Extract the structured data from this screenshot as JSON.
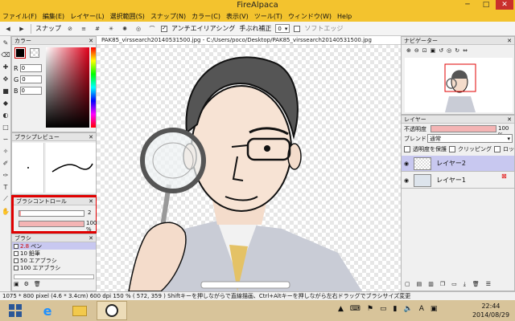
{
  "window": {
    "title": "FireAlpaca"
  },
  "menu": [
    "ファイル(F)",
    "編集(E)",
    "レイヤー(L)",
    "選択範囲(S)",
    "スナップ(N)",
    "カラー(C)",
    "表示(V)",
    "ツール(T)",
    "ウィンドウ(W)",
    "Help"
  ],
  "toolbar": {
    "snap_label": "スナップ",
    "antialias_label": "アンチエイリアシング",
    "stabilizer_label": "手ぶれ補正",
    "stabilizer_value": "0",
    "soft_edge_label": "ソフトエッジ"
  },
  "color_panel": {
    "title": "カラー",
    "r_label": "R",
    "g_label": "G",
    "b_label": "B",
    "r": "0",
    "g": "0",
    "b": "0",
    "fg_color": "#000000"
  },
  "brush_preview": {
    "title": "ブラシプレビュー"
  },
  "brush_control": {
    "title": "ブラシコントロール",
    "size_value": "2",
    "opacity_value": "100 %",
    "highlight_color": "#e00000"
  },
  "brush_panel": {
    "title": "ブラシ",
    "items": [
      {
        "size": "2.8",
        "name": "ペン",
        "selected": true
      },
      {
        "size": "10",
        "name": "鉛筆",
        "selected": false
      },
      {
        "size": "50",
        "name": "エアブラシ",
        "selected": false
      },
      {
        "size": "100",
        "name": "エアブラシ",
        "selected": false
      }
    ]
  },
  "document": {
    "tab_title": "PAK85_virssearch20140531500.jpg - C:/Users/poco/Desktop/PAK85_virssearch20140531500.jpg"
  },
  "navigator": {
    "title": "ナビゲーター"
  },
  "layers": {
    "title": "レイヤー",
    "opacity_label": "不透明度",
    "opacity_value": "100 %",
    "blend_label": "ブレンド",
    "blend_value": "通常",
    "protect_label": "透明度を保護",
    "clipping_label": "クリッピング",
    "lock_label": "ロック",
    "items": [
      {
        "name": "レイヤー2",
        "selected": true
      },
      {
        "name": "レイヤー1",
        "selected": false
      }
    ]
  },
  "status": {
    "text": "1075 * 800 pixel   (4.6 * 3.4cm)   600 dpi   150 %   ( 572, 359 )   Shiftキーを押しながらで直線描画、Ctrl+Altキーを押しながら左右ドラッグでブラシサイズ変更"
  },
  "taskbar": {
    "time": "22:44",
    "date": "2014/08/29",
    "ime": "A"
  }
}
